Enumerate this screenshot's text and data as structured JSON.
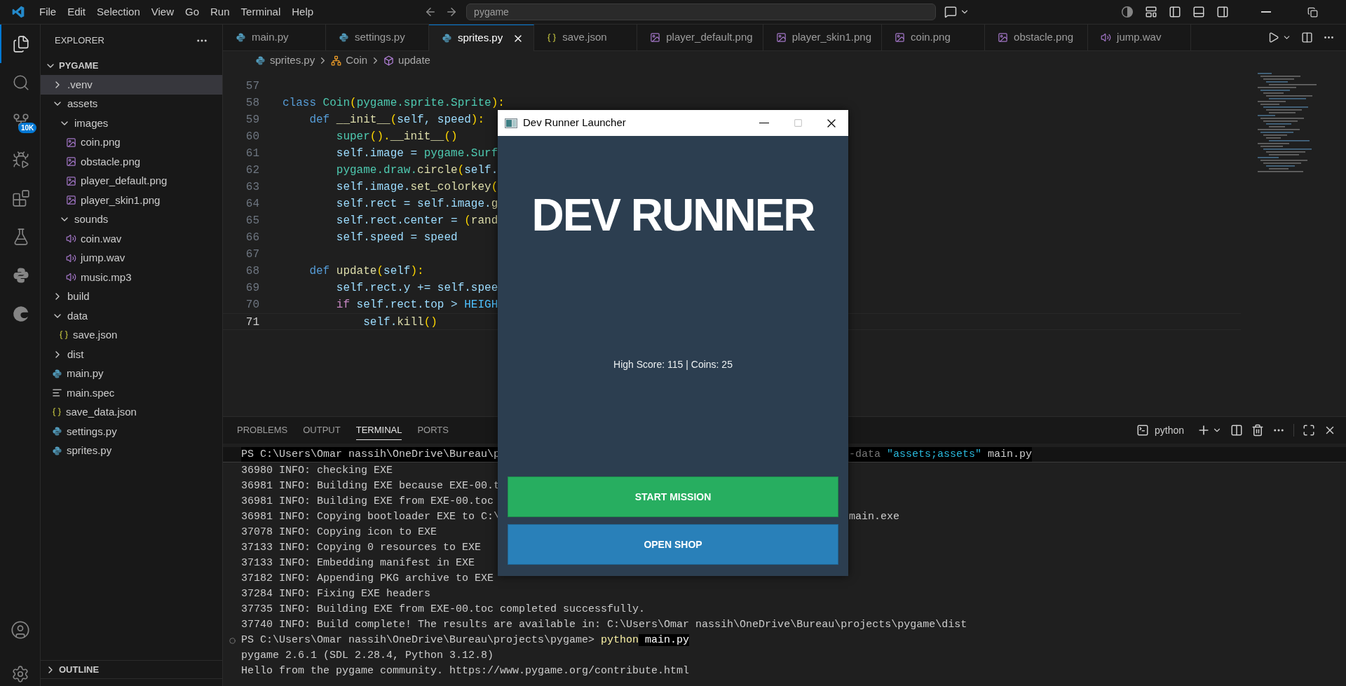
{
  "titlebar": {
    "menus": [
      "File",
      "Edit",
      "Selection",
      "View",
      "Go",
      "Run",
      "Terminal",
      "Help"
    ],
    "search": "pygame"
  },
  "activity_bar": {
    "items": [
      {
        "kind": "files",
        "selected": true
      },
      {
        "kind": "search",
        "selected": false
      },
      {
        "kind": "source_control",
        "selected": false,
        "badge": "10K"
      },
      {
        "kind": "run_debug",
        "selected": false
      },
      {
        "kind": "extensions",
        "selected": false
      },
      {
        "kind": "testing",
        "selected": false
      },
      {
        "kind": "python",
        "selected": false
      },
      {
        "kind": "edge",
        "selected": false
      }
    ]
  },
  "sidebar": {
    "title": "EXPLORER",
    "root": {
      "label": "PYGAME",
      "expanded": true
    },
    "items": [
      {
        "label": ".venv",
        "kind": "folder",
        "expanded": false,
        "selected": true
      },
      {
        "label": "assets",
        "kind": "folder",
        "expanded": true,
        "selected": false,
        "children": [
          {
            "label": "images",
            "kind": "folder",
            "expanded": true,
            "selected": false,
            "children": [
              {
                "label": "coin.png",
                "kind": "image",
                "selected": false
              },
              {
                "label": "obstacle.png",
                "kind": "image",
                "selected": false
              },
              {
                "label": "player_default.png",
                "kind": "image",
                "selected": false
              },
              {
                "label": "player_skin1.png",
                "kind": "image",
                "selected": false
              }
            ]
          },
          {
            "label": "sounds",
            "kind": "folder",
            "expanded": true,
            "selected": false,
            "children": [
              {
                "label": "coin.wav",
                "kind": "audio",
                "selected": false
              },
              {
                "label": "jump.wav",
                "kind": "audio",
                "selected": false
              },
              {
                "label": "music.mp3",
                "kind": "audio",
                "selected": false
              }
            ]
          }
        ]
      },
      {
        "label": "build",
        "kind": "folder",
        "expanded": false,
        "selected": false
      },
      {
        "label": "data",
        "kind": "folder",
        "expanded": true,
        "selected": false,
        "children": [
          {
            "label": "save.json",
            "kind": "json",
            "selected": false
          }
        ]
      },
      {
        "label": "dist",
        "kind": "folder",
        "expanded": false,
        "selected": false
      },
      {
        "label": "main.py",
        "kind": "python",
        "selected": false
      },
      {
        "label": "main.spec",
        "kind": "spec",
        "selected": false
      },
      {
        "label": "save_data.json",
        "kind": "json",
        "selected": false
      },
      {
        "label": "settings.py",
        "kind": "python",
        "selected": false
      },
      {
        "label": "sprites.py",
        "kind": "python",
        "selected": false
      }
    ],
    "outline": {
      "label": "OUTLINE",
      "expanded": false
    }
  },
  "tabs": [
    {
      "label": "main.py",
      "kind": "python",
      "selected": false
    },
    {
      "label": "settings.py",
      "kind": "python",
      "selected": false
    },
    {
      "label": "sprites.py",
      "kind": "python",
      "selected": true
    },
    {
      "label": "save.json",
      "kind": "json",
      "selected": false
    },
    {
      "label": "player_default.png",
      "kind": "image",
      "selected": false
    },
    {
      "label": "player_skin1.png",
      "kind": "image",
      "selected": false
    },
    {
      "label": "coin.png",
      "kind": "image",
      "selected": false
    },
    {
      "label": "obstacle.png",
      "kind": "image",
      "selected": false
    },
    {
      "label": "jump.wav",
      "kind": "audio",
      "selected": false
    }
  ],
  "breadcrumb": [
    {
      "label": "sprites.py",
      "kind": "python"
    },
    {
      "label": "Coin",
      "kind": "class"
    },
    {
      "label": "update",
      "kind": "method"
    }
  ],
  "code": {
    "lines": [
      {
        "number": "57",
        "current": false
      },
      {
        "number": "58",
        "current": false,
        "tokens": [
          {
            "text": "class ",
            "kind": "keyword"
          },
          {
            "text": "Coin",
            "kind": "type"
          },
          {
            "text": "(",
            "kind": "bracket"
          },
          {
            "text": "pygame.sprite.Sprite",
            "kind": "type"
          },
          {
            "text": "):",
            "kind": "bracket"
          }
        ]
      },
      {
        "number": "59",
        "current": false,
        "tokens": [
          {
            "text": "    def ",
            "kind": "keyword"
          },
          {
            "text": "__init__",
            "kind": "function"
          },
          {
            "text": "(",
            "kind": "bracket"
          },
          {
            "text": "self, speed",
            "kind": "variable"
          },
          {
            "text": "):",
            "kind": "bracket"
          }
        ]
      },
      {
        "number": "60",
        "current": false,
        "tokens": [
          {
            "text": "        super",
            "kind": "type"
          },
          {
            "text": "().",
            "kind": "bracket"
          },
          {
            "text": "__init__",
            "kind": "function"
          },
          {
            "text": "()",
            "kind": "bracket"
          }
        ]
      },
      {
        "number": "61",
        "current": false,
        "tokens": [
          {
            "text": "        self.image = ",
            "kind": "variable"
          },
          {
            "text": "pygame.Surf",
            "kind": "type"
          }
        ]
      },
      {
        "number": "62",
        "current": false,
        "tokens": [
          {
            "text": "        pygame.draw.",
            "kind": "type"
          },
          {
            "text": "circle",
            "kind": "function"
          },
          {
            "text": "(",
            "kind": "bracket"
          },
          {
            "text": "self.",
            "kind": "variable"
          }
        ]
      },
      {
        "number": "63",
        "current": false,
        "tokens": [
          {
            "text": "        self.image.",
            "kind": "variable"
          },
          {
            "text": "set_colorkey",
            "kind": "function"
          },
          {
            "text": "(",
            "kind": "bracket"
          }
        ]
      },
      {
        "number": "64",
        "current": false,
        "tokens": [
          {
            "text": "        self.rect = self.image.",
            "kind": "variable"
          },
          {
            "text": "g",
            "kind": "function"
          }
        ]
      },
      {
        "number": "65",
        "current": false,
        "tokens": [
          {
            "text": "        self.rect.center = ",
            "kind": "variable"
          },
          {
            "text": "(",
            "kind": "bracket"
          },
          {
            "text": "rand",
            "kind": "function"
          }
        ]
      },
      {
        "number": "66",
        "current": false,
        "tokens": [
          {
            "text": "        self.speed = speed",
            "kind": "variable"
          }
        ]
      },
      {
        "number": "67",
        "current": false
      },
      {
        "number": "68",
        "current": false,
        "tokens": [
          {
            "text": "    def ",
            "kind": "keyword"
          },
          {
            "text": "update",
            "kind": "function"
          },
          {
            "text": "(",
            "kind": "bracket"
          },
          {
            "text": "self",
            "kind": "variable"
          },
          {
            "text": "):",
            "kind": "bracket"
          }
        ]
      },
      {
        "number": "69",
        "current": false,
        "tokens": [
          {
            "text": "        self.rect.y += self.spee",
            "kind": "variable"
          }
        ]
      },
      {
        "number": "70",
        "current": false,
        "tokens": [
          {
            "text": "        if",
            "kind": "control"
          },
          {
            "text": " self.rect.top > ",
            "kind": "variable"
          },
          {
            "text": "HEIGH",
            "kind": "constant"
          }
        ]
      },
      {
        "number": "71",
        "current": true,
        "tokens": [
          {
            "text": "            self.",
            "kind": "variable"
          },
          {
            "text": "kill",
            "kind": "function"
          },
          {
            "text": "()",
            "kind": "bracket"
          }
        ]
      }
    ]
  },
  "panel": {
    "tabs": [
      {
        "label": "PROBLEMS",
        "selected": false
      },
      {
        "label": "OUTPUT",
        "selected": false
      },
      {
        "label": "TERMINAL",
        "selected": true
      },
      {
        "label": "PORTS",
        "selected": false
      }
    ],
    "profile": "python",
    "lines": [
      {
        "sticky": true,
        "decorated": false,
        "segments": [
          {
            "text": "PS C:\\Users\\Omar nassih\\OneDrive\\Bureau\\p",
            "kind": "plain"
          }
        ],
        "right": [
          {
            "text": "-data ",
            "kind": "dim"
          },
          {
            "text": "\"assets;assets\"",
            "kind": "string"
          },
          {
            "text": " main.py",
            "kind": "plain"
          }
        ]
      },
      {
        "sticky": false,
        "decorated": false,
        "segments": [
          {
            "text": "36980 INFO: checking EXE",
            "kind": "plain"
          }
        ]
      },
      {
        "sticky": false,
        "decorated": false,
        "segments": [
          {
            "text": "36981 INFO: Building EXE because EXE-00.t",
            "kind": "plain"
          }
        ]
      },
      {
        "sticky": false,
        "decorated": false,
        "segments": [
          {
            "text": "36981 INFO: Building EXE from EXE-00.toc",
            "kind": "plain"
          }
        ]
      },
      {
        "sticky": false,
        "decorated": false,
        "segments": [
          {
            "text": "36981 INFO: Copying bootloader EXE to C:\\",
            "kind": "plain"
          }
        ],
        "right": [
          {
            "text": "main.exe",
            "kind": "plain"
          }
        ]
      },
      {
        "sticky": false,
        "decorated": false,
        "segments": [
          {
            "text": "37078 INFO: Copying icon to EXE",
            "kind": "plain"
          }
        ]
      },
      {
        "sticky": false,
        "decorated": false,
        "segments": [
          {
            "text": "37133 INFO: Copying 0 resources to EXE",
            "kind": "plain"
          }
        ]
      },
      {
        "sticky": false,
        "decorated": false,
        "segments": [
          {
            "text": "37133 INFO: Embedding manifest in EXE",
            "kind": "plain"
          }
        ]
      },
      {
        "sticky": false,
        "decorated": false,
        "segments": [
          {
            "text": "37182 INFO: Appending PKG archive to EXE",
            "kind": "plain"
          }
        ]
      },
      {
        "sticky": false,
        "decorated": false,
        "segments": [
          {
            "text": "37284 INFO: Fixing EXE headers",
            "kind": "plain"
          }
        ]
      },
      {
        "sticky": false,
        "decorated": false,
        "segments": [
          {
            "text": "37735 INFO: Building EXE from EXE-00.toc completed successfully.",
            "kind": "plain"
          }
        ]
      },
      {
        "sticky": false,
        "decorated": false,
        "segments": [
          {
            "text": "37740 INFO: Build complete! The results are available in: C:\\Users\\Omar nassih\\OneDrive\\Bureau\\projects\\pygame\\dist",
            "kind": "plain"
          }
        ]
      },
      {
        "sticky": false,
        "decorated": true,
        "segments": [
          {
            "text": "PS C:\\Users\\Omar nassih\\OneDrive\\Bureau\\projects\\pygame> ",
            "kind": "plain"
          },
          {
            "text": "python",
            "kind": "cmd"
          },
          {
            "text": " main.py",
            "kind": "highlight"
          }
        ]
      },
      {
        "sticky": false,
        "decorated": false,
        "segments": [
          {
            "text": "pygame 2.6.1 (SDL 2.28.4, Python 3.12.8)",
            "kind": "plain"
          }
        ]
      },
      {
        "sticky": false,
        "decorated": false,
        "segments": [
          {
            "text": "Hello from the pygame community. https://www.pygame.org/contribute.html",
            "kind": "plain"
          }
        ]
      }
    ]
  },
  "dialog": {
    "title": "Dev Runner Launcher",
    "maximize_enabled": false,
    "heading": "DEV RUNNER",
    "stats": "High Score: 115 | Coins: 25",
    "buttons": [
      {
        "label": "START MISSION",
        "color": "#27ae60"
      },
      {
        "label": "OPEN SHOP",
        "color": "#2980b9"
      }
    ]
  }
}
